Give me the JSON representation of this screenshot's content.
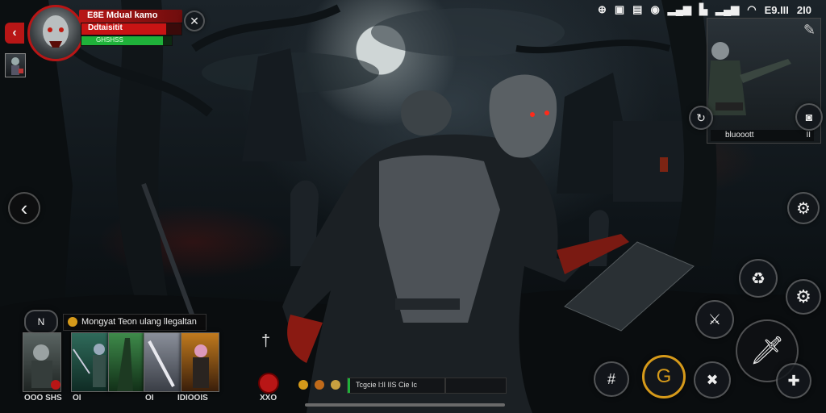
{
  "player": {
    "name": "E8E Mdual kamo",
    "subtitle": "Ddtaisitit",
    "health_fraction": 0.85,
    "exp_fraction": 0.9,
    "health_color": "#c81414",
    "exp_color": "#1fb13a",
    "exp_label": "GHSHSS"
  },
  "status_bar": {
    "clock": "E9.III",
    "time": "2I0",
    "icons": [
      "android-icon",
      "notification-icon",
      "battery-icon",
      "record-icon",
      "signal-icon",
      "sim-icon",
      "signal-icon-2",
      "wifi-icon"
    ]
  },
  "minimap": {
    "label": "bluooott",
    "count": "II"
  },
  "quest": {
    "title": "Mongyat Teon ulang llegaltan",
    "count": "N"
  },
  "cards": [
    {
      "label": "OOO SHS"
    },
    {
      "label": "OI"
    },
    {
      "label": "OI"
    },
    {
      "label": "IDIOOIS"
    }
  ],
  "item_count": "XXO",
  "chat": {
    "text": "Tcgcie l:lI IIS Cie Ic"
  },
  "colors": {
    "accent_red": "#c81414",
    "accent_green": "#1fb13a",
    "gold": "#d69a1a"
  }
}
